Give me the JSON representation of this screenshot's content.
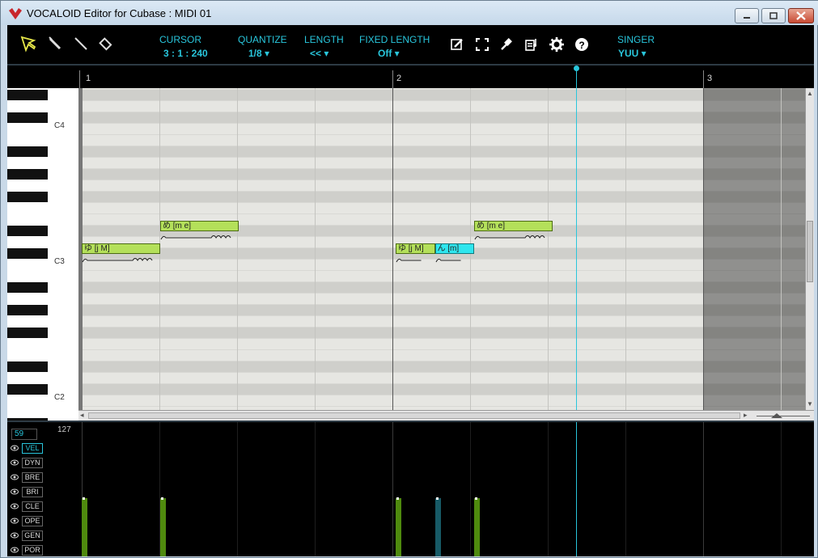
{
  "window": {
    "title": "VOCALOID Editor for Cubase : MIDI 01"
  },
  "toolbar": {
    "tools": [
      "arrow-tool",
      "pencil-tool",
      "line-tool",
      "eraser-tool"
    ],
    "cursor": {
      "label": "CURSOR",
      "value": "3 : 1 : 240"
    },
    "quantize": {
      "label": "QUANTIZE",
      "value": "1/8"
    },
    "length": {
      "label": "LENGTH",
      "value": "<<"
    },
    "fixed_length": {
      "label": "FIXED LENGTH",
      "value": "Off"
    },
    "singer": {
      "label": "SINGER",
      "value": "YUU"
    },
    "icons": [
      "edit-icon",
      "expand-icon",
      "hammer-icon",
      "lyrics-icon",
      "gear-icon",
      "help-icon"
    ],
    "accent_color": "#29c6dc"
  },
  "ruler": {
    "marks": [
      "1",
      "2",
      "3"
    ]
  },
  "keyboard": {
    "labels": [
      "C4",
      "C3",
      "C2"
    ]
  },
  "notes": [
    {
      "lyric": "め [m e]",
      "pitch": "D#3",
      "start": 0.25,
      "length": 0.25,
      "selected": false
    },
    {
      "lyric": "め [m e]",
      "pitch": "D#3",
      "start": 1.25,
      "length": 0.25,
      "selected": false
    },
    {
      "lyric": "ゆ [j M]",
      "pitch": "C#3",
      "start": 0.0,
      "length": 0.25,
      "selected": false
    },
    {
      "lyric": "ゆ [j M]",
      "pitch": "C#3",
      "start": 1.0,
      "length": 0.125,
      "selected": false
    },
    {
      "lyric": "ん [m]",
      "pitch": "C#3",
      "start": 1.125,
      "length": 0.125,
      "selected": true
    }
  ],
  "control": {
    "value": "59",
    "max": "127",
    "params": [
      "VEL",
      "DYN",
      "BRE",
      "BRI",
      "CLE",
      "OPE",
      "GEN",
      "POR"
    ],
    "active": "VEL"
  }
}
